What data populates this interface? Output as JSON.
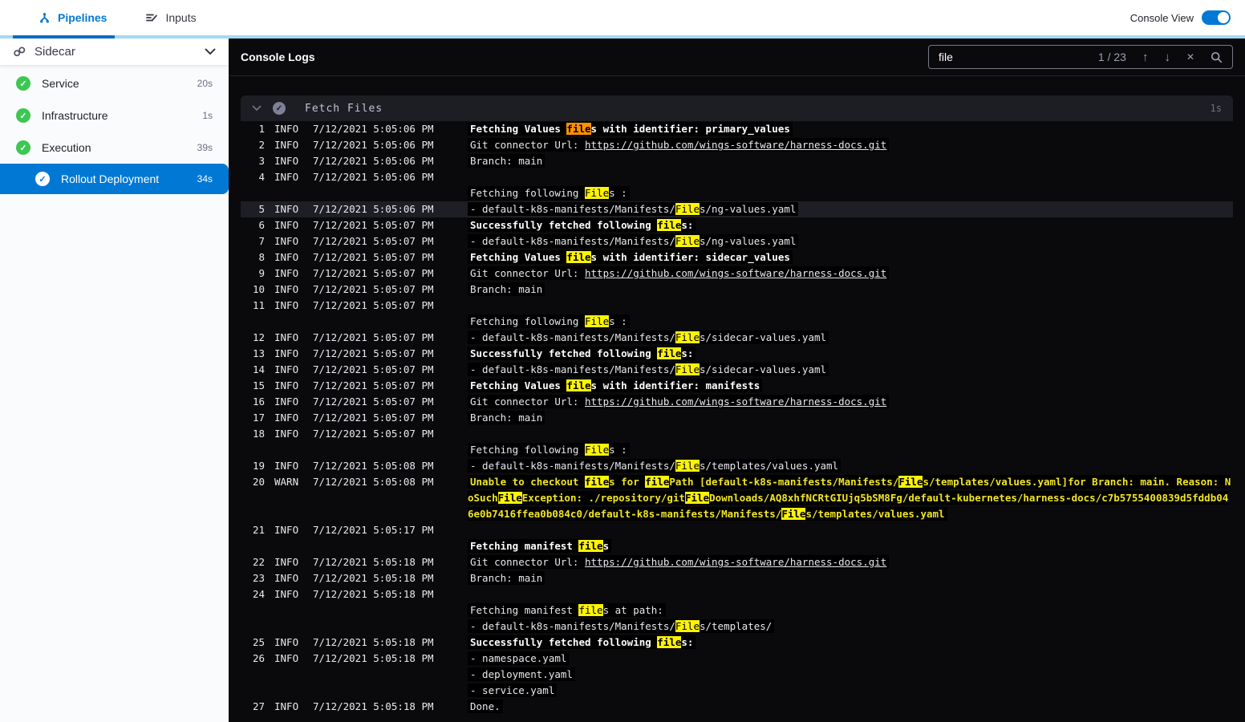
{
  "topbar": {
    "tabs": [
      {
        "label": "Pipelines"
      },
      {
        "label": "Inputs"
      }
    ],
    "console_view_label": "Console View",
    "console_view_on": true
  },
  "sidebar": {
    "stage": {
      "name": "Sidecar"
    },
    "steps": [
      {
        "label": "Service",
        "duration": "20s",
        "status": "success",
        "selected": false
      },
      {
        "label": "Infrastructure",
        "duration": "1s",
        "status": "success",
        "selected": false
      },
      {
        "label": "Execution",
        "duration": "39s",
        "status": "success",
        "selected": false
      },
      {
        "label": "Rollout Deployment",
        "duration": "34s",
        "status": "success",
        "selected": true
      }
    ]
  },
  "console": {
    "title": "Console Logs",
    "search": {
      "value": "file",
      "counter": "1 / 23",
      "term": "file"
    },
    "section": {
      "title": "Fetch Files",
      "duration": "1s"
    },
    "logs": [
      {
        "n": 1,
        "level": "INFO",
        "time": "7/12/2021 5:05:06 PM",
        "lines": [
          {
            "t": "Fetching Values files with identifier: primary_values",
            "b": true
          }
        ]
      },
      {
        "n": 2,
        "level": "INFO",
        "time": "7/12/2021 5:05:06 PM",
        "lines": [
          {
            "t": "Git connector Url: https://github.com/wings-software/harness-docs.git",
            "b": false
          }
        ]
      },
      {
        "n": 3,
        "level": "INFO",
        "time": "7/12/2021 5:05:06 PM",
        "lines": [
          {
            "t": "Branch: main",
            "b": false
          }
        ]
      },
      {
        "n": 4,
        "level": "INFO",
        "time": "7/12/2021 5:05:06 PM",
        "lines": [
          {
            "t": "",
            "b": false
          },
          {
            "t": "Fetching following Files :",
            "b": false
          }
        ]
      },
      {
        "n": 5,
        "level": "INFO",
        "time": "7/12/2021 5:05:06 PM",
        "sel": true,
        "lines": [
          {
            "t": "- default-k8s-manifests/Manifests/Files/ng-values.yaml",
            "b": false
          }
        ]
      },
      {
        "n": 6,
        "level": "INFO",
        "time": "7/12/2021 5:05:07 PM",
        "lines": [
          {
            "t": "Successfully fetched following files:",
            "b": true
          }
        ]
      },
      {
        "n": 7,
        "level": "INFO",
        "time": "7/12/2021 5:05:07 PM",
        "lines": [
          {
            "t": "- default-k8s-manifests/Manifests/Files/ng-values.yaml",
            "b": false
          }
        ]
      },
      {
        "n": 8,
        "level": "INFO",
        "time": "7/12/2021 5:05:07 PM",
        "lines": [
          {
            "t": "Fetching Values files with identifier: sidecar_values",
            "b": true
          }
        ]
      },
      {
        "n": 9,
        "level": "INFO",
        "time": "7/12/2021 5:05:07 PM",
        "lines": [
          {
            "t": "Git connector Url: https://github.com/wings-software/harness-docs.git",
            "b": false
          }
        ]
      },
      {
        "n": 10,
        "level": "INFO",
        "time": "7/12/2021 5:05:07 PM",
        "lines": [
          {
            "t": "Branch: main",
            "b": false
          }
        ]
      },
      {
        "n": 11,
        "level": "INFO",
        "time": "7/12/2021 5:05:07 PM",
        "lines": [
          {
            "t": "",
            "b": false
          },
          {
            "t": "Fetching following Files :",
            "b": false
          }
        ]
      },
      {
        "n": 12,
        "level": "INFO",
        "time": "7/12/2021 5:05:07 PM",
        "lines": [
          {
            "t": "- default-k8s-manifests/Manifests/Files/sidecar-values.yaml",
            "b": false
          }
        ]
      },
      {
        "n": 13,
        "level": "INFO",
        "time": "7/12/2021 5:05:07 PM",
        "lines": [
          {
            "t": "Successfully fetched following files:",
            "b": true
          }
        ]
      },
      {
        "n": 14,
        "level": "INFO",
        "time": "7/12/2021 5:05:07 PM",
        "lines": [
          {
            "t": "- default-k8s-manifests/Manifests/Files/sidecar-values.yaml",
            "b": false
          }
        ]
      },
      {
        "n": 15,
        "level": "INFO",
        "time": "7/12/2021 5:05:07 PM",
        "lines": [
          {
            "t": "Fetching Values files with identifier: manifests",
            "b": true
          }
        ]
      },
      {
        "n": 16,
        "level": "INFO",
        "time": "7/12/2021 5:05:07 PM",
        "lines": [
          {
            "t": "Git connector Url: https://github.com/wings-software/harness-docs.git",
            "b": false
          }
        ]
      },
      {
        "n": 17,
        "level": "INFO",
        "time": "7/12/2021 5:05:07 PM",
        "lines": [
          {
            "t": "Branch: main",
            "b": false
          }
        ]
      },
      {
        "n": 18,
        "level": "INFO",
        "time": "7/12/2021 5:05:07 PM",
        "lines": [
          {
            "t": "",
            "b": false
          },
          {
            "t": "Fetching following Files :",
            "b": false
          }
        ]
      },
      {
        "n": 19,
        "level": "INFO",
        "time": "7/12/2021 5:05:08 PM",
        "lines": [
          {
            "t": "- default-k8s-manifests/Manifests/Files/templates/values.yaml",
            "b": false
          }
        ]
      },
      {
        "n": 20,
        "level": "WARN",
        "time": "7/12/2021 5:05:08 PM",
        "lines": [
          {
            "t": "Unable to checkout files for filePath [default-k8s-manifests/Manifests/Files/templates/values.yaml]for Branch: main. Reason: NoSuchFileException: ./repository/gitFileDownloads/AQ8xhfNCRtGIUjq5bSM8Fg/default-kubernetes/harness-docs/c7b5755400839d5fddb046e0b7416ffea0b084c0/default-k8s-manifests/Manifests/Files/templates/values.yaml",
            "b": true
          }
        ]
      },
      {
        "n": 21,
        "level": "INFO",
        "time": "7/12/2021 5:05:17 PM",
        "lines": [
          {
            "t": "",
            "b": false
          },
          {
            "t": "Fetching manifest files",
            "b": true
          }
        ]
      },
      {
        "n": 22,
        "level": "INFO",
        "time": "7/12/2021 5:05:18 PM",
        "lines": [
          {
            "t": "Git connector Url: https://github.com/wings-software/harness-docs.git",
            "b": false
          }
        ]
      },
      {
        "n": 23,
        "level": "INFO",
        "time": "7/12/2021 5:05:18 PM",
        "lines": [
          {
            "t": "Branch: main",
            "b": false
          }
        ]
      },
      {
        "n": 24,
        "level": "INFO",
        "time": "7/12/2021 5:05:18 PM",
        "lines": [
          {
            "t": "",
            "b": false
          },
          {
            "t": "Fetching manifest files at path:",
            "b": false
          },
          {
            "t": "- default-k8s-manifests/Manifests/Files/templates/",
            "b": false
          }
        ]
      },
      {
        "n": 25,
        "level": "INFO",
        "time": "7/12/2021 5:05:18 PM",
        "lines": [
          {
            "t": "Successfully fetched following files:",
            "b": true
          }
        ]
      },
      {
        "n": 26,
        "level": "INFO",
        "time": "7/12/2021 5:05:18 PM",
        "lines": [
          {
            "t": "- namespace.yaml",
            "b": false
          },
          {
            "t": "- deployment.yaml",
            "b": false
          },
          {
            "t": "- service.yaml",
            "b": false
          }
        ]
      },
      {
        "n": 27,
        "level": "INFO",
        "time": "7/12/2021 5:05:18 PM",
        "lines": [
          {
            "t": "Done.",
            "b": false
          }
        ]
      }
    ]
  },
  "colors": {
    "accent_blue": "#0278d5",
    "success_green": "#3dc752",
    "warn_text": "#f0e525",
    "match_highlight": "#fdf303",
    "current_match": "#ff9100",
    "tab_underline_light": "#a3d9f2"
  }
}
